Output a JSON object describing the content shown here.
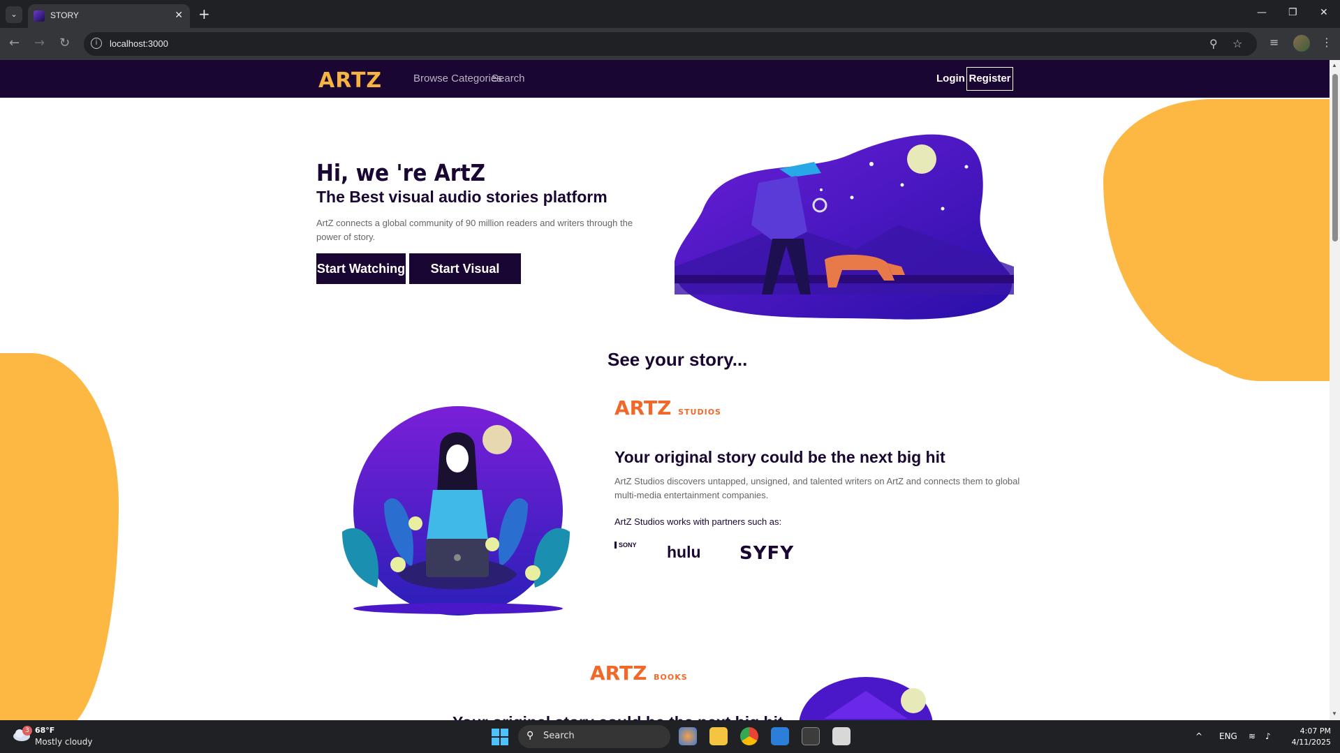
{
  "browser": {
    "tab_title": "STORY",
    "url": "localhost:3000"
  },
  "site": {
    "logo_text": "ARTZ",
    "nav": {
      "browse": "Browse Categories",
      "search": "Search",
      "login": "Login",
      "register": "Register"
    },
    "hero": {
      "title": "Hi, we 're ArtZ",
      "subtitle": "The Best visual audio stories platform",
      "description": "ArtZ connects a global community of 90 million readers and writers through the power of story.",
      "btn_watch": "Start Watching",
      "btn_write": "Start Visual Writing"
    },
    "section_title": "See your story...",
    "studios": {
      "logo": "ARTZ",
      "logo_suffix": "STUDIOS",
      "heading": "Your original story could be the next big hit",
      "description": "ArtZ Studios discovers untapped, unsigned, and talented writers on ArtZ and connects them to global multi-media entertainment companies.",
      "partners_label": "ArtZ Studios works with partners such as:",
      "partners": [
        "SONY",
        "hulu",
        "SYFY"
      ]
    },
    "books": {
      "logo": "ARTZ",
      "logo_suffix": "BOOKS",
      "heading": "Your original story could be the next big hit"
    },
    "colors": {
      "nav_bg": "#1a0632",
      "accent_yellow": "#fcb843",
      "accent_orange": "#f0692a",
      "purple": "#4a18c8"
    }
  },
  "taskbar": {
    "weather_badge": "3",
    "weather_temp": "68°F",
    "weather_cond": "Mostly cloudy",
    "search_placeholder": "Search",
    "language": "ENG",
    "time": "4:07 PM",
    "date": "4/11/2025"
  }
}
